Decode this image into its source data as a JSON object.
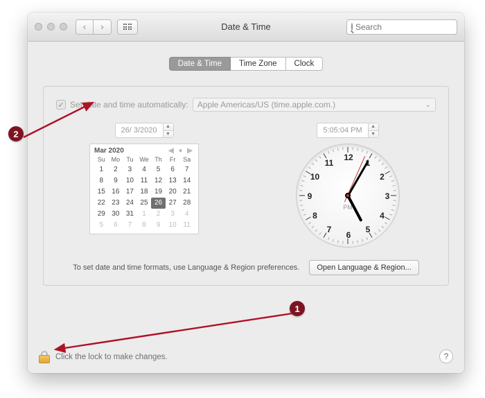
{
  "window": {
    "title": "Date & Time"
  },
  "search": {
    "placeholder": "Search"
  },
  "tabs": {
    "t1": "Date & Time",
    "t2": "Time Zone",
    "t3": "Clock"
  },
  "auto": {
    "label": "Set date and time automatically:",
    "server": "Apple Americas/US (time.apple.com.)"
  },
  "date": {
    "value": "26/  3/2020"
  },
  "time": {
    "value": "5:05:04 PM"
  },
  "calendar": {
    "month_label": "Mar 2020",
    "dows": [
      "Su",
      "Mo",
      "Tu",
      "We",
      "Th",
      "Fr",
      "Sa"
    ],
    "cells": [
      {
        "d": "1"
      },
      {
        "d": "2"
      },
      {
        "d": "3"
      },
      {
        "d": "4"
      },
      {
        "d": "5"
      },
      {
        "d": "6"
      },
      {
        "d": "7"
      },
      {
        "d": "8"
      },
      {
        "d": "9"
      },
      {
        "d": "10"
      },
      {
        "d": "11"
      },
      {
        "d": "12"
      },
      {
        "d": "13"
      },
      {
        "d": "14"
      },
      {
        "d": "15"
      },
      {
        "d": "16"
      },
      {
        "d": "17"
      },
      {
        "d": "18"
      },
      {
        "d": "19"
      },
      {
        "d": "20"
      },
      {
        "d": "21"
      },
      {
        "d": "22"
      },
      {
        "d": "23"
      },
      {
        "d": "24"
      },
      {
        "d": "25"
      },
      {
        "d": "26",
        "today": true
      },
      {
        "d": "27"
      },
      {
        "d": "28"
      },
      {
        "d": "29"
      },
      {
        "d": "30"
      },
      {
        "d": "31"
      },
      {
        "d": "1",
        "off": true
      },
      {
        "d": "2",
        "off": true
      },
      {
        "d": "3",
        "off": true
      },
      {
        "d": "4",
        "off": true
      },
      {
        "d": "5",
        "off": true
      },
      {
        "d": "6",
        "off": true
      },
      {
        "d": "7",
        "off": true
      },
      {
        "d": "8",
        "off": true
      },
      {
        "d": "9",
        "off": true
      },
      {
        "d": "10",
        "off": true
      },
      {
        "d": "11",
        "off": true
      }
    ]
  },
  "clock": {
    "hour_angle": 152,
    "min_angle": 30,
    "sec_angle": 24,
    "pm_label": "PM",
    "nums": [
      "12",
      "1",
      "2",
      "3",
      "4",
      "5",
      "6",
      "7",
      "8",
      "9",
      "10",
      "11"
    ]
  },
  "formats_hint": "To set date and time formats, use Language & Region preferences.",
  "open_lang_btn": "Open Language & Region...",
  "lock_text": "Click the lock to make changes.",
  "annotations": {
    "a1": "1",
    "a2": "2"
  }
}
